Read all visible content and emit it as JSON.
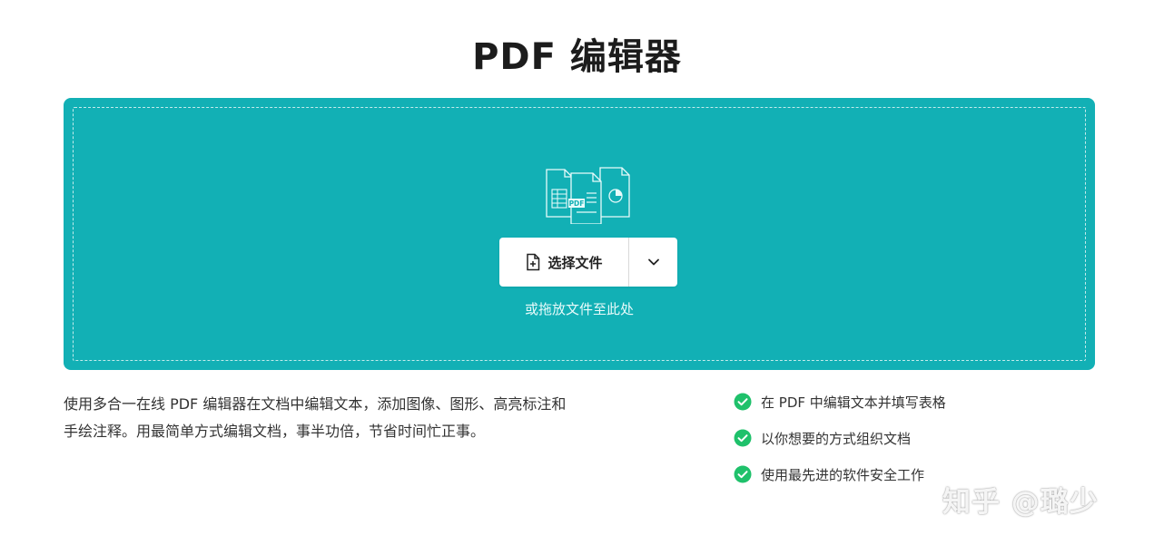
{
  "title": "PDF 编辑器",
  "upload": {
    "choose_label": "选择文件",
    "drop_hint": "或拖放文件至此处",
    "illustration_badge": "PDF"
  },
  "description": {
    "line1": "使用多合一在线 PDF 编辑器在文档中编辑文本，添加图像、图形、高亮标注和",
    "line2": "手绘注释。用最简单方式编辑文档，事半功倍，节省时间忙正事。"
  },
  "features": [
    "在 PDF 中编辑文本并填写表格",
    "以你想要的方式组织文档",
    "使用最先进的软件安全工作"
  ],
  "watermark": "知乎 @璐少",
  "colors": {
    "accent": "#12b0b5",
    "check": "#1fc16b",
    "title": "#1c1c1c"
  },
  "icons": {
    "choose": "file-plus-icon",
    "dropdown": "chevron-down-icon",
    "feature": "check-circle-icon",
    "illustration": "documents-illustration-icon"
  }
}
